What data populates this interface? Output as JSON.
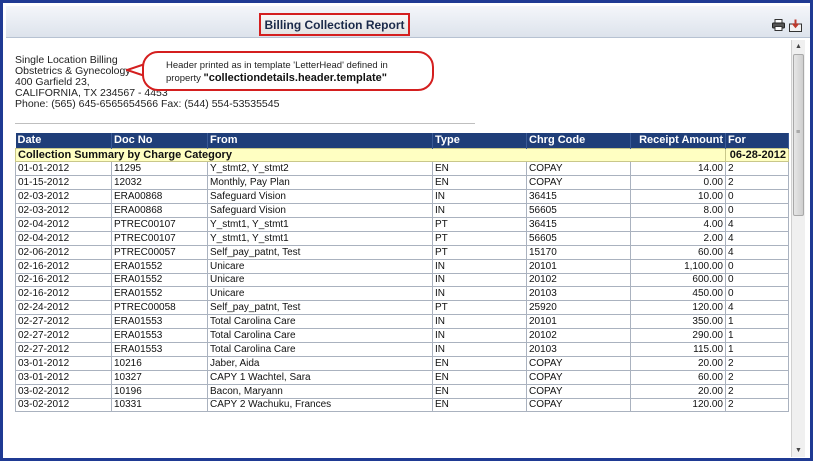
{
  "report": {
    "title": "Billing Collection Report"
  },
  "toolbar": {
    "print_icon": "printer-icon",
    "export_icon": "export-icon"
  },
  "letterhead": {
    "lines": [
      "Single Location Billing",
      "Obstetrics & Gynecology",
      "400 Garfield 23,",
      "CALIFORNIA, TX 234567 - 4453",
      "Phone: (565) 645-6565654566 Fax: (544) 554-53535545"
    ]
  },
  "callout": {
    "text_1": "Header printed as in template 'LetterHead' defined in",
    "text_2": "property",
    "property_name": "\"collectiondetails.header.template\""
  },
  "table": {
    "headers": [
      "Date",
      "Doc No",
      "From",
      "Type",
      "Chrg Code",
      "Receipt Amount",
      "For"
    ],
    "summary_label": "Collection Summary by Charge Category",
    "summary_date": "06-28-2012",
    "rows": [
      [
        "01-01-2012",
        "11295",
        "Y_stmt2, Y_stmt2",
        "EN",
        "COPAY",
        "14.00",
        "2"
      ],
      [
        "01-15-2012",
        "12032",
        "Monthly, Pay Plan",
        "EN",
        "COPAY",
        "0.00",
        "2"
      ],
      [
        "02-03-2012",
        "ERA00868",
        "Safeguard Vision",
        "IN",
        "36415",
        "10.00",
        "0"
      ],
      [
        "02-03-2012",
        "ERA00868",
        "Safeguard Vision",
        "IN",
        "56605",
        "8.00",
        "0"
      ],
      [
        "02-04-2012",
        "PTREC00107",
        "Y_stmt1, Y_stmt1",
        "PT",
        "36415",
        "4.00",
        "4"
      ],
      [
        "02-04-2012",
        "PTREC00107",
        "Y_stmt1, Y_stmt1",
        "PT",
        "56605",
        "2.00",
        "4"
      ],
      [
        "02-06-2012",
        "PTREC00057",
        "Self_pay_patnt, Test",
        "PT",
        "15170",
        "60.00",
        "4"
      ],
      [
        "02-16-2012",
        "ERA01552",
        "Unicare",
        "IN",
        "20101",
        "1,100.00",
        "0"
      ],
      [
        "02-16-2012",
        "ERA01552",
        "Unicare",
        "IN",
        "20102",
        "600.00",
        "0"
      ],
      [
        "02-16-2012",
        "ERA01552",
        "Unicare",
        "IN",
        "20103",
        "450.00",
        "0"
      ],
      [
        "02-24-2012",
        "PTREC00058",
        "Self_pay_patnt, Test",
        "PT",
        "25920",
        "120.00",
        "4"
      ],
      [
        "02-27-2012",
        "ERA01553",
        "Total Carolina Care",
        "IN",
        "20101",
        "350.00",
        "1"
      ],
      [
        "02-27-2012",
        "ERA01553",
        "Total Carolina Care",
        "IN",
        "20102",
        "290.00",
        "1"
      ],
      [
        "02-27-2012",
        "ERA01553",
        "Total Carolina Care",
        "IN",
        "20103",
        "115.00",
        "1"
      ],
      [
        "03-01-2012",
        "10216",
        "Jaber, Aida",
        "EN",
        "COPAY",
        "20.00",
        "2"
      ],
      [
        "03-01-2012",
        "10327",
        "CAPY 1 Wachtel, Sara",
        "EN",
        "COPAY",
        "60.00",
        "2"
      ],
      [
        "03-02-2012",
        "10196",
        "Bacon, Maryann",
        "EN",
        "COPAY",
        "20.00",
        "2"
      ],
      [
        "03-02-2012",
        "10331",
        "CAPY 2 Wachuku, Frances",
        "EN",
        "COPAY",
        "120.00",
        "2"
      ]
    ]
  },
  "scrollbar": {
    "position": 0.0
  }
}
